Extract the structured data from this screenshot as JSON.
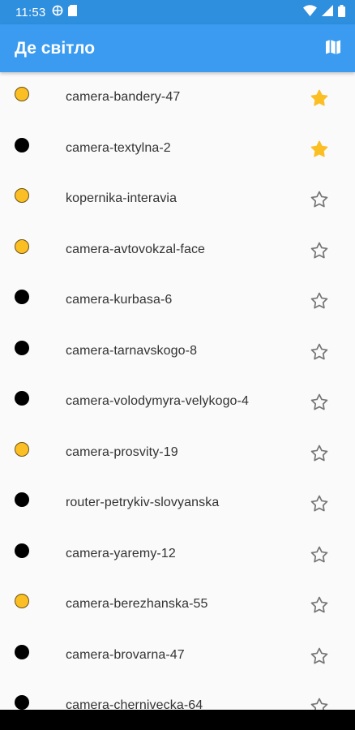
{
  "status_bar": {
    "time": "11:53",
    "left_icons": [
      "vpn-globe-icon",
      "sd-card-icon"
    ],
    "right_icons": [
      "wifi-icon",
      "cellular-signal-icon",
      "battery-icon"
    ]
  },
  "app_bar": {
    "title": "Де світло",
    "action_icon": "map-icon"
  },
  "colors": {
    "status_bar": "#2f8fdf",
    "app_bar": "#3a9bf0",
    "partial": "#fbbf24",
    "off": "#000000",
    "star_filled": "#fbbf24",
    "star_outline": "#757575"
  },
  "items": [
    {
      "label": "camera-bandery-47",
      "status": "partial",
      "favorite": true
    },
    {
      "label": "camera-textylna-2",
      "status": "off",
      "favorite": true
    },
    {
      "label": "kopernika-interavia",
      "status": "partial",
      "favorite": false
    },
    {
      "label": "camera-avtovokzal-face",
      "status": "partial",
      "favorite": false
    },
    {
      "label": "camera-kurbasa-6",
      "status": "off",
      "favorite": false
    },
    {
      "label": "camera-tarnavskogo-8",
      "status": "off",
      "favorite": false
    },
    {
      "label": "camera-volodymyra-velykogo-4",
      "status": "off",
      "favorite": false
    },
    {
      "label": "camera-prosvity-19",
      "status": "partial",
      "favorite": false
    },
    {
      "label": "router-petrykiv-slovyanska",
      "status": "off",
      "favorite": false
    },
    {
      "label": "camera-yaremy-12",
      "status": "off",
      "favorite": false
    },
    {
      "label": "camera-berezhanska-55",
      "status": "partial",
      "favorite": false
    },
    {
      "label": "camera-brovarna-47",
      "status": "off",
      "favorite": false
    },
    {
      "label": "camera-chernivecka-64",
      "status": "off",
      "favorite": false
    }
  ]
}
